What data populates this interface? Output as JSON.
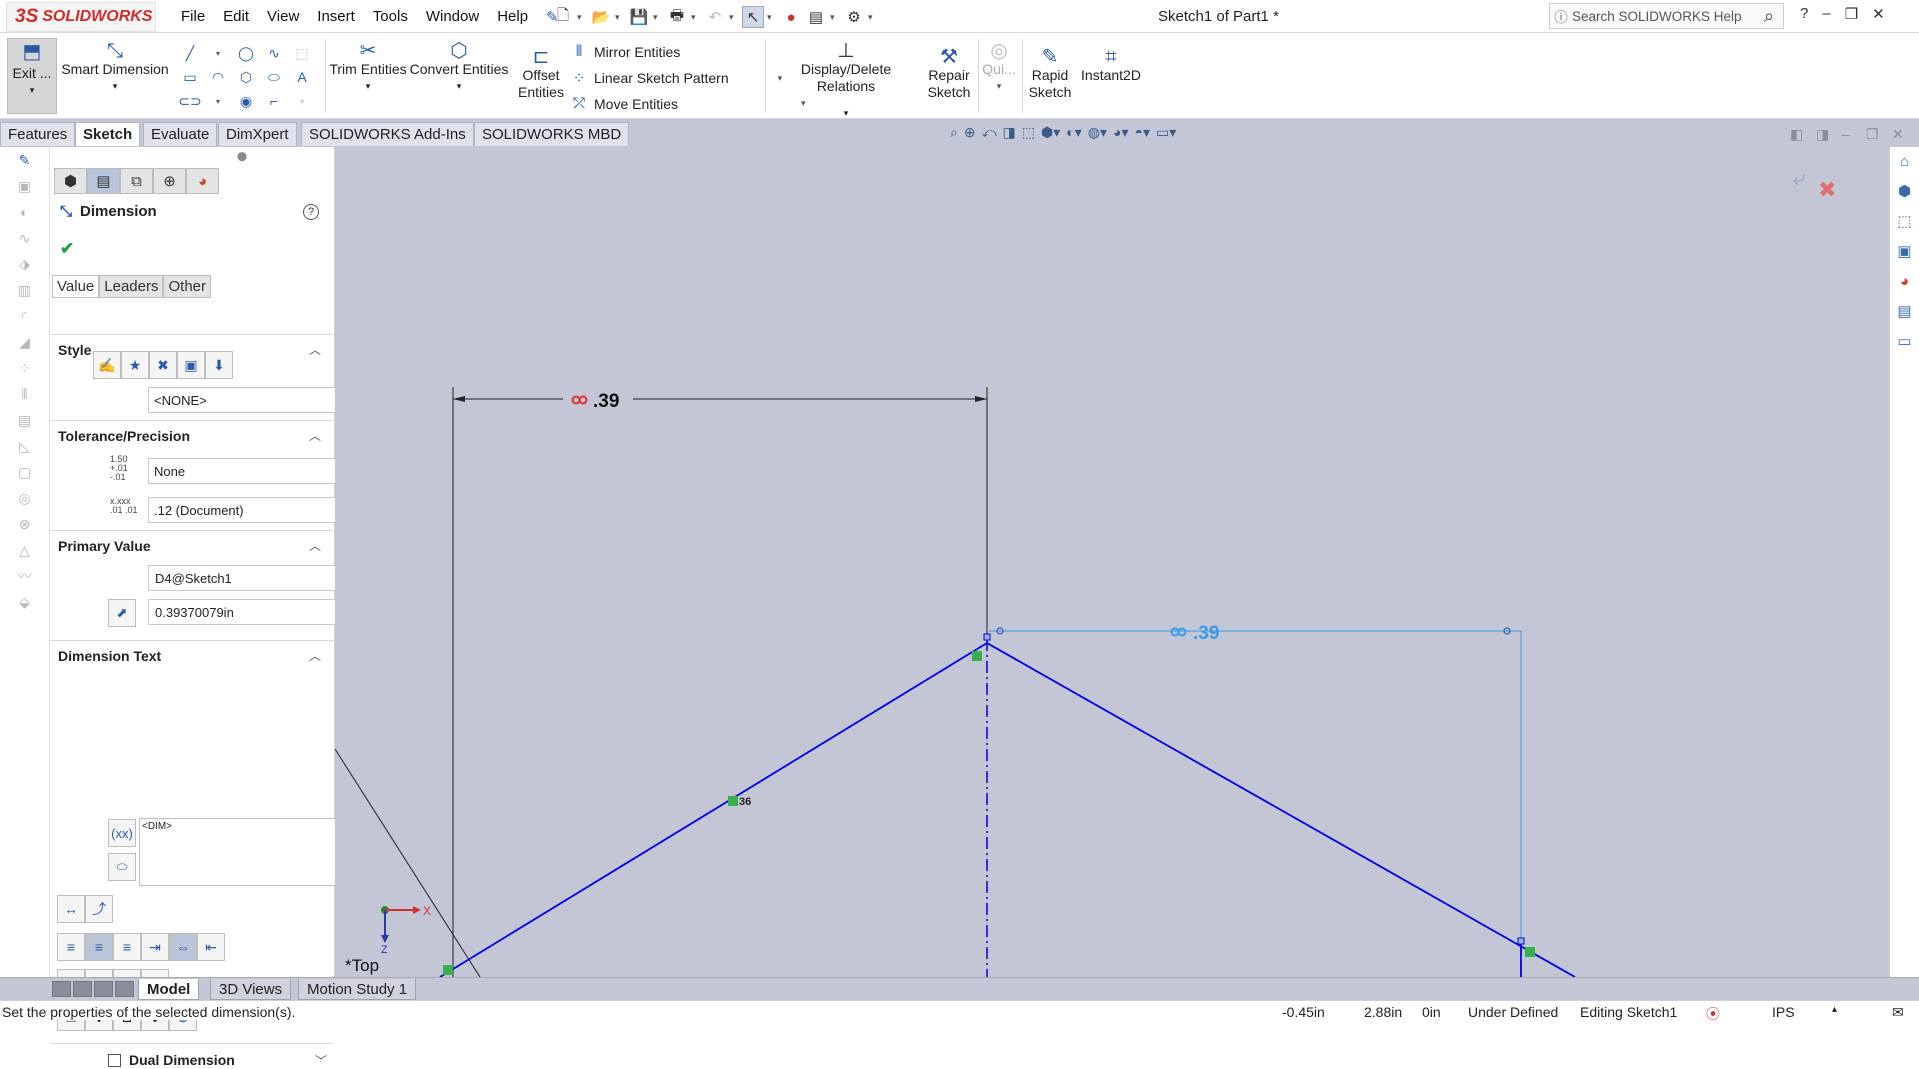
{
  "app": {
    "logo_text": "SOLIDWORKS",
    "logo_mark": "3S",
    "document_title": "Sketch1 of Part1 *"
  },
  "menu": [
    "File",
    "Edit",
    "View",
    "Insert",
    "Tools",
    "Window",
    "Help"
  ],
  "search": {
    "placeholder": "Search SOLIDWORKS Help"
  },
  "command_manager": {
    "exit_label": "Exit ...",
    "smart_dimension": "Smart Dimension",
    "trim_entities": "Trim Entities",
    "convert_entities": "Convert Entities",
    "offset_entities_1": "Offset",
    "offset_entities_2": "Entities",
    "mirror_entities": "Mirror Entities",
    "linear_sketch_pattern": "Linear Sketch Pattern",
    "move_entities": "Move Entities",
    "display_delete_relations": "Display/Delete Relations",
    "repair_sketch_1": "Repair",
    "repair_sketch_2": "Sketch",
    "quick_snaps": "Qui...",
    "rapid_sketch_1": "Rapid",
    "rapid_sketch_2": "Sketch",
    "instant2d": "Instant2D"
  },
  "tabs": [
    "Features",
    "Sketch",
    "Evaluate",
    "DimXpert",
    "SOLIDWORKS Add-Ins",
    "SOLIDWORKS MBD"
  ],
  "active_tab": "Sketch",
  "property_manager": {
    "title": "Dimension",
    "subtabs": [
      "Value",
      "Leaders",
      "Other"
    ],
    "style_header": "Style",
    "style_value": "<NONE>",
    "tolerance_header": "Tolerance/Precision",
    "tolerance_type": "None",
    "precision": ".12 (Document)",
    "tol_icon_text": "1.50 +.01 -.01",
    "prec_icon_text": "x.xxx .01 .01",
    "primary_header": "Primary Value",
    "dimension_name": "D4@Sketch1",
    "dimension_value": "0.39370079in",
    "dimtext_header": "Dimension Text",
    "dimtext_value": "<DIM>",
    "dual_label": "Dual Dimension"
  },
  "viewport": {
    "dim_top": ".39",
    "dim_right": ".39",
    "relation_label": "36",
    "view_label": "*Top",
    "axis_x": "X",
    "axis_z": "Z"
  },
  "bottom_tabs": [
    "Model",
    "3D Views",
    "Motion Study 1"
  ],
  "status": {
    "message": "Set the properties of the selected dimension(s).",
    "x": "-0.45in",
    "y": "2.88in",
    "z": "0in",
    "state": "Under Defined",
    "editing": "Editing Sketch1",
    "units": "IPS"
  },
  "colors": {
    "sketch_blue": "#0000e6",
    "dim_blue": "#3a9ae8",
    "viewport_bg": "#c3c6d5",
    "brand_red": "#d42a2a"
  }
}
